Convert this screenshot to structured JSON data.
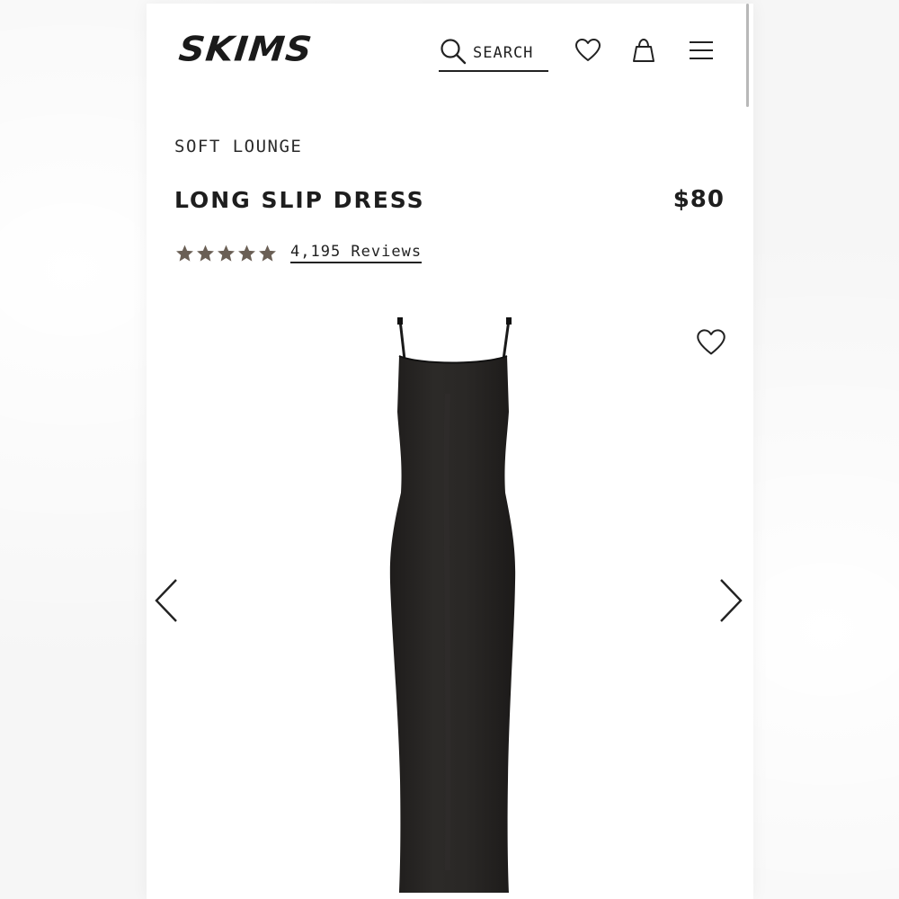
{
  "header": {
    "logo_text": "SKIMS",
    "search_label": "SEARCH",
    "icons": [
      "search-icon",
      "heart-icon",
      "shopping-bag-icon",
      "menu-icon"
    ]
  },
  "product": {
    "category": "SOFT LOUNGE",
    "title": "LONG SLIP DRESS",
    "price": "$80",
    "rating": {
      "stars": 5,
      "reviews_label": "4,195 Reviews"
    }
  },
  "gallery": {
    "image_subject": "black long slip dress",
    "controls": [
      "chevron-left-icon",
      "chevron-right-icon",
      "heart-icon"
    ]
  },
  "colors": {
    "text": "#1e1e1e",
    "star": "#6a5f55",
    "dress": "#262422"
  }
}
